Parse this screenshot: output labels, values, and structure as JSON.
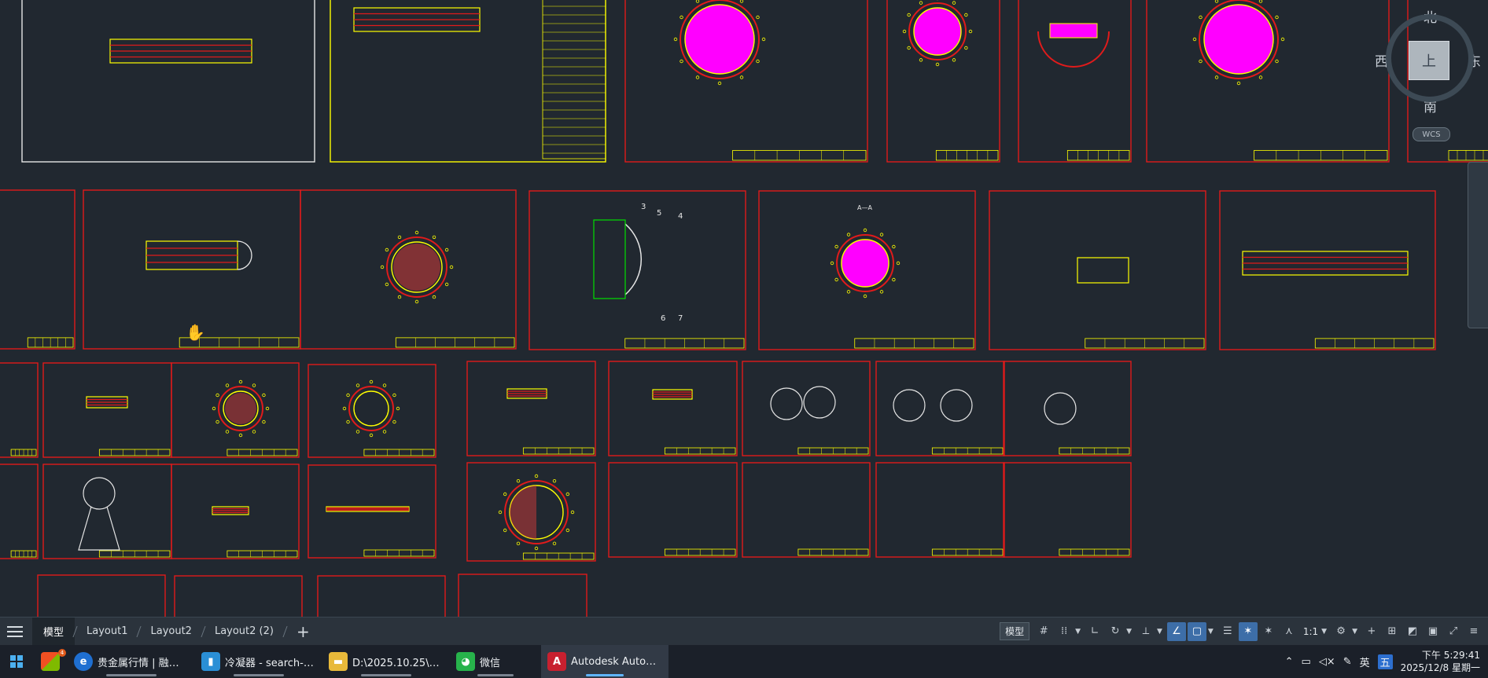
{
  "viewcube": {
    "north": "北",
    "south": "南",
    "west": "西",
    "east": "东",
    "top_face": "上",
    "wcs": "WCS"
  },
  "drawing_labels": {
    "nums_a": "3",
    "nums_b": "5",
    "nums_c": "4",
    "nums_d": "6",
    "nums_e": "7",
    "section": "A—A"
  },
  "layout_tabs": {
    "tabs": [
      "模型",
      "Layout1",
      "Layout2",
      "Layout2 (2)"
    ],
    "active": "模型",
    "add": "+"
  },
  "statusbar": {
    "mode": "模型",
    "scale": "1:1"
  },
  "taskbar": {
    "apps": [
      {
        "label": "贵金属行情 | 融通...",
        "color": "#1f6fd1",
        "glyph": "e"
      },
      {
        "label": "冷凝器 - search-m...",
        "color": "#2a8fd6",
        "glyph": "▮"
      },
      {
        "label": "D:\\2025.10.25\\图...",
        "color": "#e8b93a",
        "glyph": "▬"
      },
      {
        "label": "微信",
        "color": "#27b34b",
        "glyph": "◕"
      },
      {
        "label": "Autodesk AutoCA...",
        "color": "#c8202f",
        "glyph": "A"
      }
    ],
    "store_badge": "4",
    "ime": "英",
    "time": "下午 5:29:41",
    "date": "2025/12/8 星期一"
  },
  "colors": {
    "canvas": "#212830",
    "sheet_border": "#e01b1b",
    "drawing_yellow": "#ffff00",
    "drawing_green": "#00e000",
    "hatch_magenta": "#ff00ff",
    "accent": "#3d6ea8"
  }
}
